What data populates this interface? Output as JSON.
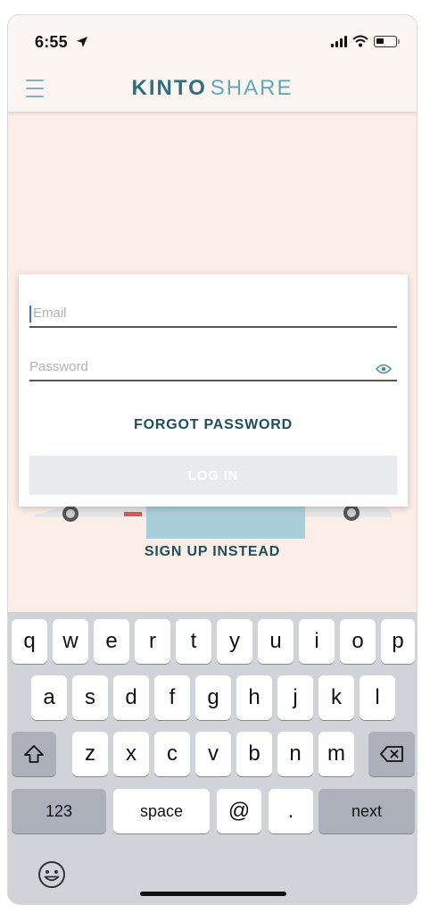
{
  "status_bar": {
    "time": "6:55"
  },
  "header": {
    "logo_part1": "KINTO",
    "logo_part2": "SHARE"
  },
  "login_form": {
    "email_placeholder": "Email",
    "password_placeholder": "Password",
    "forgot_password_label": "FORGOT PASSWORD",
    "login_label": "LOG IN"
  },
  "signup_label": "SIGN UP INSTEAD",
  "keyboard": {
    "row1": [
      "q",
      "w",
      "e",
      "r",
      "t",
      "y",
      "u",
      "i",
      "o",
      "p"
    ],
    "row2": [
      "a",
      "s",
      "d",
      "f",
      "g",
      "h",
      "j",
      "k",
      "l"
    ],
    "row3": [
      "z",
      "x",
      "c",
      "v",
      "b",
      "n",
      "m"
    ],
    "numbers_label": "123",
    "space_label": "space",
    "at_label": "@",
    "dot_label": ".",
    "next_label": "next"
  },
  "colors": {
    "brand_dark": "#2e6f7c",
    "brand_light": "#62a8b6",
    "page_background": "#fbeee7",
    "keyboard_background": "#d1d3d9"
  },
  "icons": [
    "location-arrow-icon",
    "cellular-signal-icon",
    "wifi-icon",
    "battery-icon",
    "hamburger-menu-icon",
    "eye-icon",
    "shift-icon",
    "backspace-icon",
    "emoji-icon"
  ]
}
